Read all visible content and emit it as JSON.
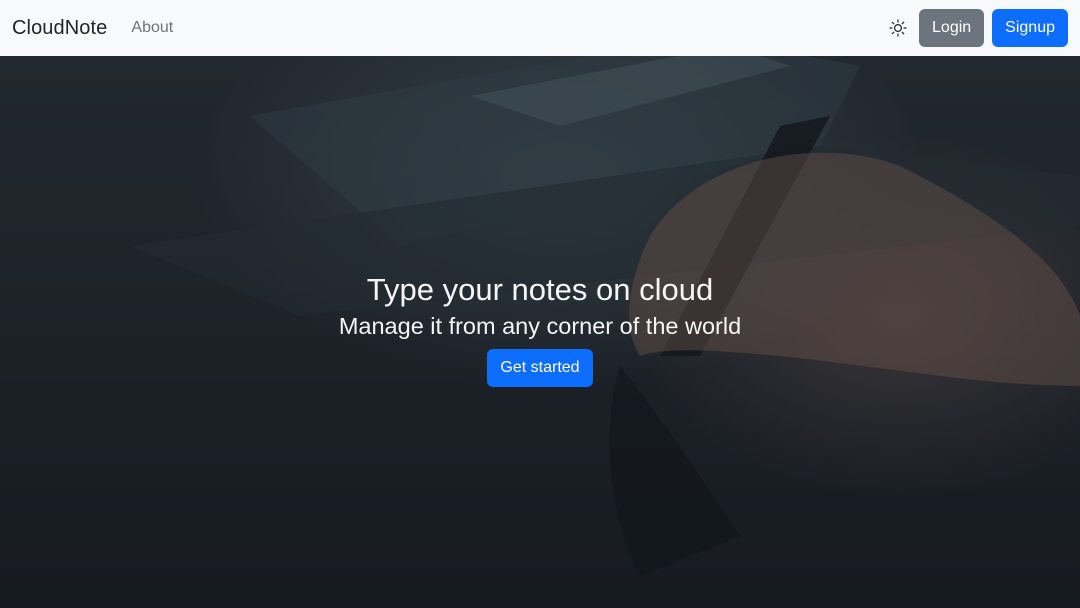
{
  "navbar": {
    "brand": "CloudNote",
    "links": [
      {
        "label": "About"
      }
    ],
    "theme_toggle_icon": "sun-icon",
    "login_label": "Login",
    "signup_label": "Signup"
  },
  "hero": {
    "title": "Type your notes on cloud",
    "subtitle": "Manage it from any corner of the world",
    "cta_label": "Get started"
  },
  "colors": {
    "primary": "#0d6efd",
    "secondary": "#6c757d",
    "navbar_bg": "#f8f9fa"
  }
}
